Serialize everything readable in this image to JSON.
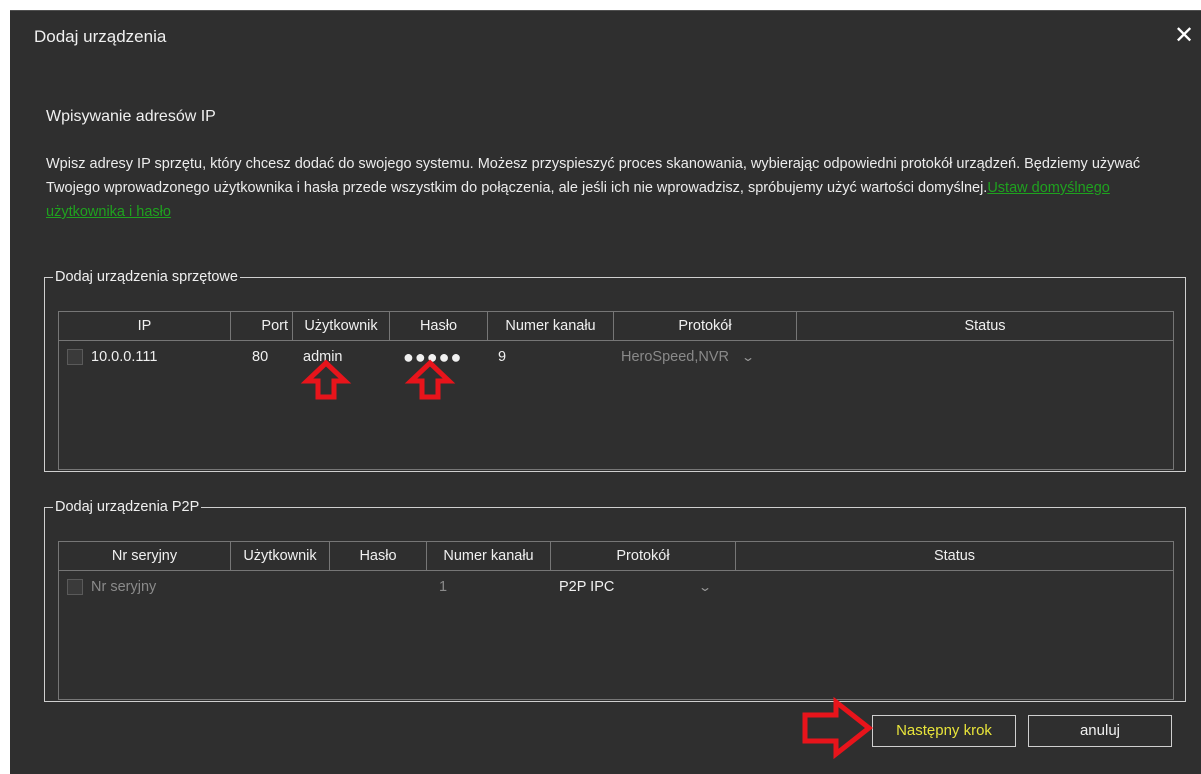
{
  "dialog": {
    "title": "Dodaj urządzenia",
    "close_label": "✕"
  },
  "section_heading": "Wpisywanie adresów IP",
  "description": {
    "text": "Wpisz adresy IP sprzętu, który chcesz dodać do swojego systemu. Możesz przyspieszyć proces skanowania, wybierając odpowiedni protokół urządzeń. Będziemy używać Twojego wprowadzonego użytkownika i hasła przede wszystkim do połączenia, ale jeśli ich nie wprowadzisz, spróbujemy użyć wartości domyślnej.",
    "link_text": "Ustaw domyślnego użytkownika i hasło"
  },
  "hardware_group": {
    "legend": "Dodaj urządzenia sprzętowe",
    "columns": [
      "IP",
      "Port",
      "Użytkownik",
      "Hasło",
      "Numer kanału",
      "Protokół",
      "Status"
    ],
    "row": {
      "ip": "10.0.0.111",
      "port": "80",
      "user": "admin",
      "password": "●●●●●",
      "channel": "9",
      "protocol": "HeroSpeed,NVR",
      "status": ""
    }
  },
  "p2p_group": {
    "legend": "Dodaj urządzenia P2P",
    "columns": [
      "Nr seryjny",
      "Użytkownik",
      "Hasło",
      "Numer kanału",
      "Protokół",
      "Status"
    ],
    "row": {
      "serial_placeholder": "Nr seryjny",
      "channel": "1",
      "protocol": "P2P IPC",
      "status": ""
    }
  },
  "buttons": {
    "next": "Następny krok",
    "cancel": "anuluj"
  },
  "colors": {
    "background": "#2f2f2f",
    "link": "#1fa21f",
    "next_button_text": "#e8e43a",
    "annotation_arrow": "#e8141b"
  },
  "icons": {
    "close": "close-icon",
    "dropdown": "chevron-down-icon",
    "annotation": "red-arrow-icon"
  }
}
